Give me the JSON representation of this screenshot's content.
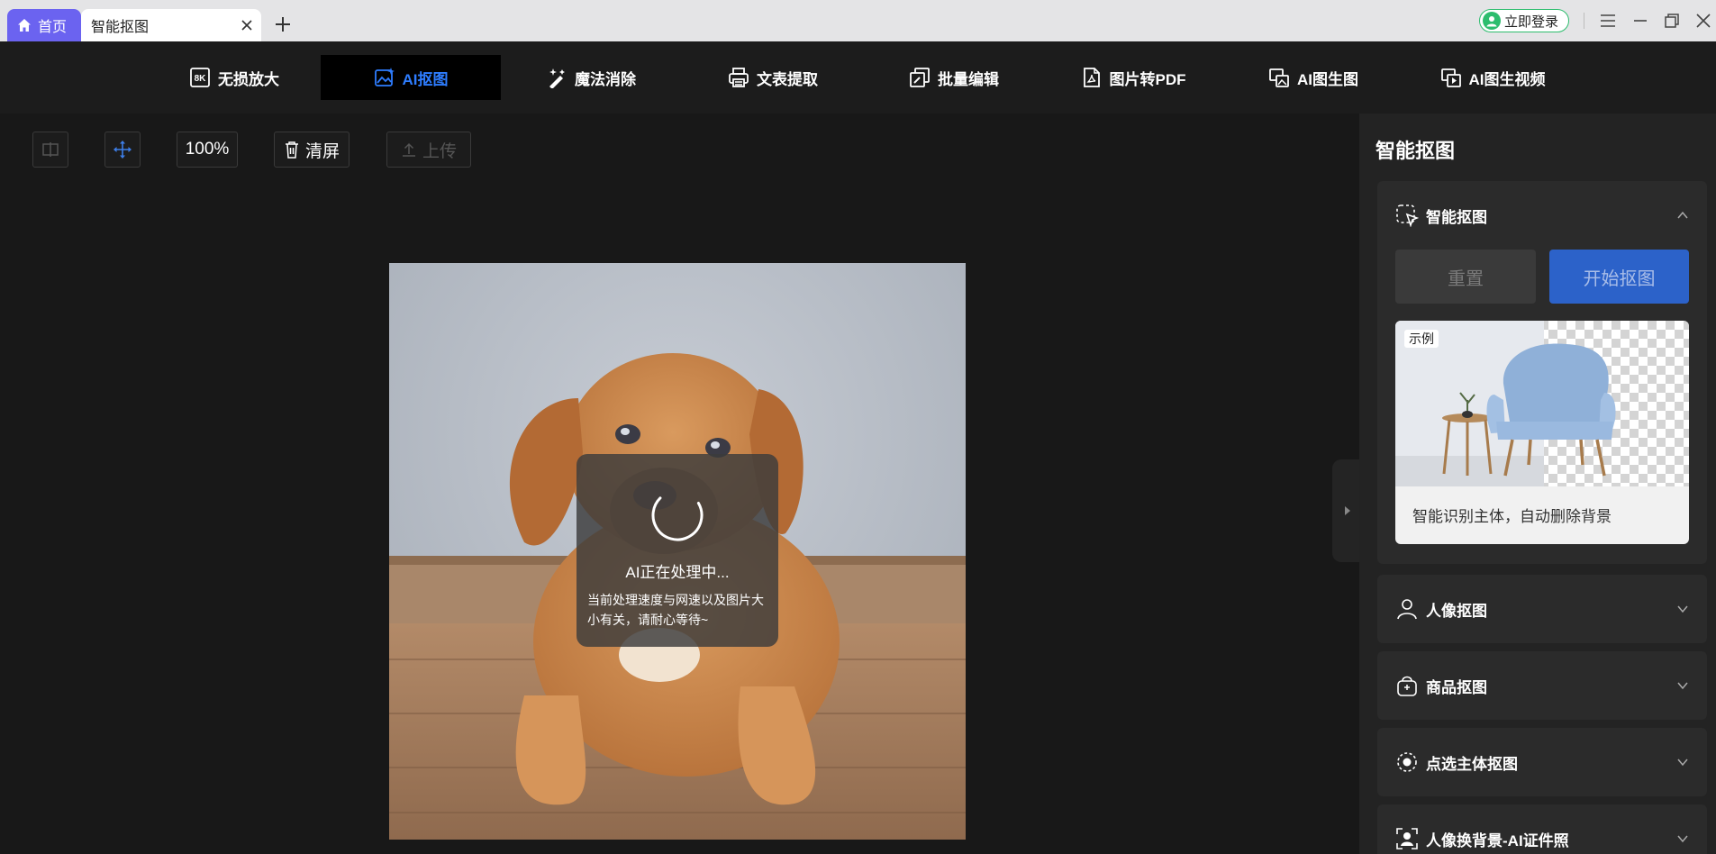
{
  "tabs": {
    "home_label": "首页",
    "active_label": "智能抠图"
  },
  "header": {
    "login_label": "立即登录"
  },
  "toolbar": {
    "items": [
      {
        "label": "无损放大",
        "icon": "8k-icon"
      },
      {
        "label": "AI抠图",
        "icon": "image-sparkle-icon",
        "active": true
      },
      {
        "label": "魔法消除",
        "icon": "magic-wand-icon"
      },
      {
        "label": "文表提取",
        "icon": "printer-icon"
      },
      {
        "label": "批量编辑",
        "icon": "batch-edit-icon"
      },
      {
        "label": "图片转PDF",
        "icon": "pdf-icon"
      },
      {
        "label": "AI图生图",
        "icon": "image-to-image-icon"
      },
      {
        "label": "AI图生视频",
        "icon": "image-to-video-icon"
      }
    ]
  },
  "canvas": {
    "zoom": "100%",
    "clear_label": "清屏",
    "upload_label": "上传",
    "processing_title": "AI正在处理中...",
    "processing_desc": "当前处理速度与网速以及图片大小有关，请耐心等待~"
  },
  "panel": {
    "title": "智能抠图",
    "sections": [
      {
        "label": "智能抠图",
        "icon": "smart-cutout-icon",
        "expanded": true
      },
      {
        "label": "人像抠图",
        "icon": "person-icon",
        "expanded": false
      },
      {
        "label": "商品抠图",
        "icon": "shopping-bag-icon",
        "expanded": false
      },
      {
        "label": "点选主体抠图",
        "icon": "target-icon",
        "expanded": false
      },
      {
        "label": "人像换背景-AI证件照",
        "icon": "portrait-frame-icon",
        "expanded": false
      }
    ],
    "reset_label": "重置",
    "start_label": "开始抠图",
    "example_tag": "示例",
    "example_desc": "智能识别主体，自动删除背景"
  },
  "colors": {
    "accent_purple": "#6b63f0",
    "accent_blue": "#2e7dff",
    "start_button": "#2c62c9",
    "login_green": "#2dbd6e"
  }
}
